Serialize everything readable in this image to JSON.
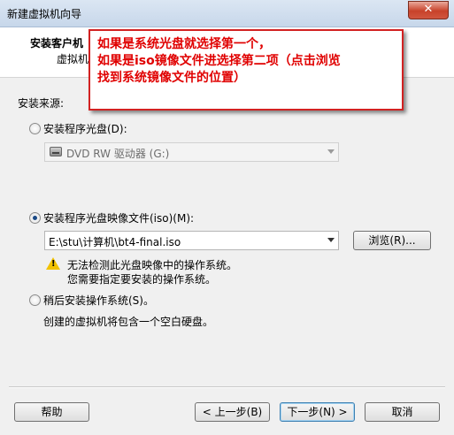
{
  "window": {
    "title": "新建虚拟机向导",
    "close_label": "✕"
  },
  "header": {
    "title": "安装客户机",
    "subtitle": "虚拟机"
  },
  "annotation": {
    "lines": [
      "如果是系统光盘就选择第一个，",
      "如果是iso镜像文件进选择第二项（点击浏览",
      "找到系统镜像文件的位置）"
    ]
  },
  "source": {
    "label": "安装来源:",
    "disc_option": "安装程序光盘(D):",
    "disc_drive": "DVD RW 驱动器 (G:)",
    "iso_option": "安装程序光盘映像文件(iso)(M):",
    "iso_path": "E:\\stu\\计算机\\bt4-final.iso",
    "browse_label": "浏览(R)...",
    "warning_line1": "无法检测此光盘映像中的操作系统。",
    "warning_line2": "您需要指定要安装的操作系统。",
    "later_option": "稍后安装操作系统(S)。",
    "later_desc": "创建的虚拟机将包含一个空白硬盘。",
    "selected": "iso"
  },
  "footer": {
    "help_label": "帮助",
    "back_label": "< 上一步(B)",
    "next_label": "下一步(N) >",
    "cancel_label": "取消"
  }
}
